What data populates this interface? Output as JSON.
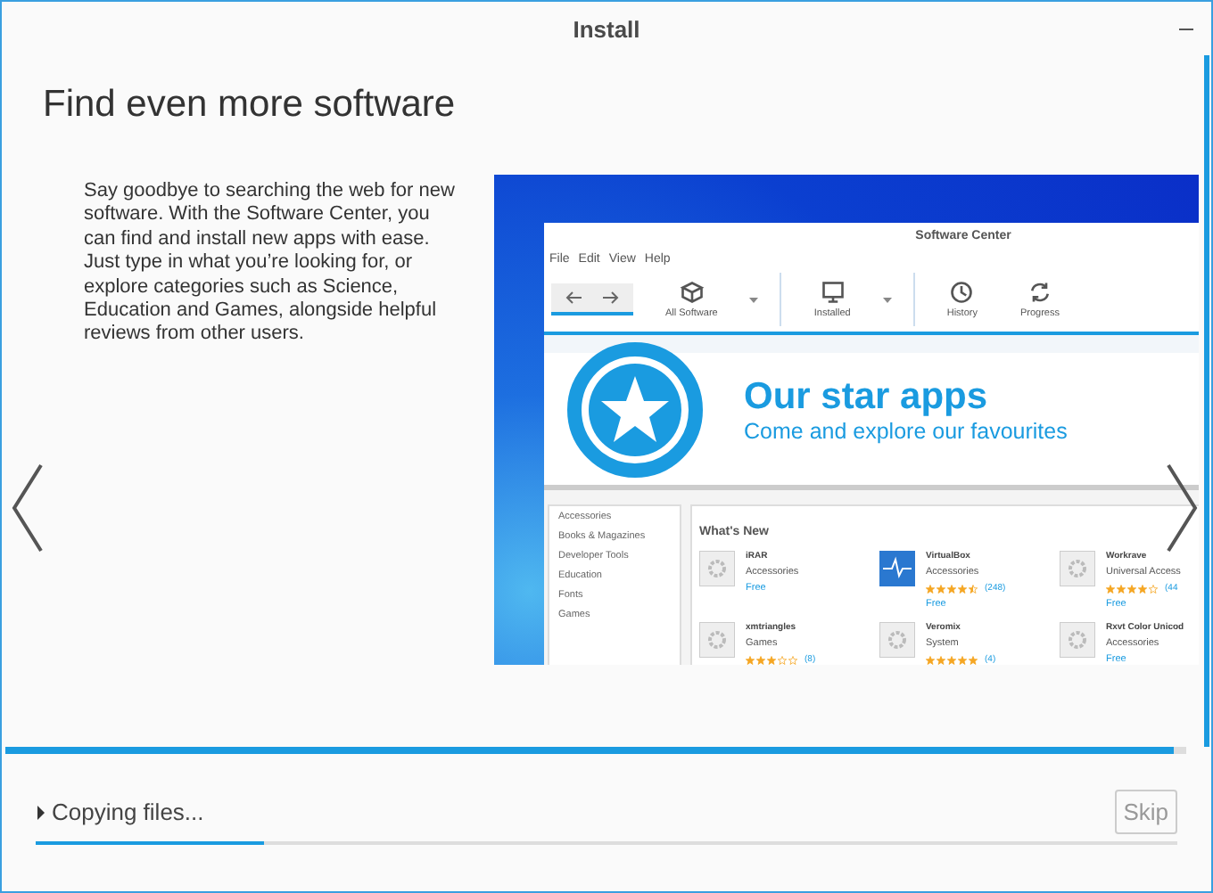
{
  "window": {
    "title": "Install"
  },
  "slide": {
    "heading": "Find even more software",
    "body": "Say goodbye to searching the web for new software. With the Software Center, you can find and install new apps with ease. Just type in what you’re looking for, or explore categories such as Science, Education and Games, alongside helpful reviews from other users.",
    "screenshot": {
      "title": "Software Center",
      "menu": [
        "File",
        "Edit",
        "View",
        "Help"
      ],
      "toolbar": [
        {
          "label": "All Software",
          "kind": "box",
          "dropdown": true
        },
        {
          "label": "Installed",
          "kind": "monitor",
          "dropdown": true
        },
        {
          "label": "History",
          "kind": "clock",
          "dropdown": false
        },
        {
          "label": "Progress",
          "kind": "sync",
          "dropdown": false
        }
      ],
      "banner": {
        "title": "Our star apps",
        "subtitle": "Come and explore our favourites"
      },
      "categories": [
        "Accessories",
        "Books & Magazines",
        "Developer Tools",
        "Education",
        "Fonts",
        "Games"
      ],
      "whats_new": {
        "title": "What's New",
        "apps": [
          {
            "name": "iRAR",
            "category": "Accessories",
            "kind": "gear",
            "price": "Free"
          },
          {
            "name": "VirtualBox",
            "category": "Accessories",
            "kind": "pulse",
            "stars": 4.5,
            "count": "(248)",
            "price": "Free"
          },
          {
            "name": "Workrave",
            "category": "Universal Access",
            "kind": "gear",
            "stars": 4,
            "count": "(44",
            "price": "Free"
          },
          {
            "name": "xmtriangles",
            "category": "Games",
            "kind": "gear",
            "stars": 3,
            "count": "(8)"
          },
          {
            "name": "Veromix",
            "category": "System",
            "kind": "gear",
            "stars": 5,
            "count": "(4)"
          },
          {
            "name": "Rxvt Color Unicod",
            "category": "Accessories",
            "kind": "gear",
            "price": "Free"
          }
        ]
      }
    }
  },
  "slide_progress": {
    "level": 0.99
  },
  "status": {
    "label": "Copying files...",
    "expanded": false,
    "level": 0.2
  },
  "buttons": [
    {
      "label": "Skip",
      "disabled": true
    }
  ]
}
